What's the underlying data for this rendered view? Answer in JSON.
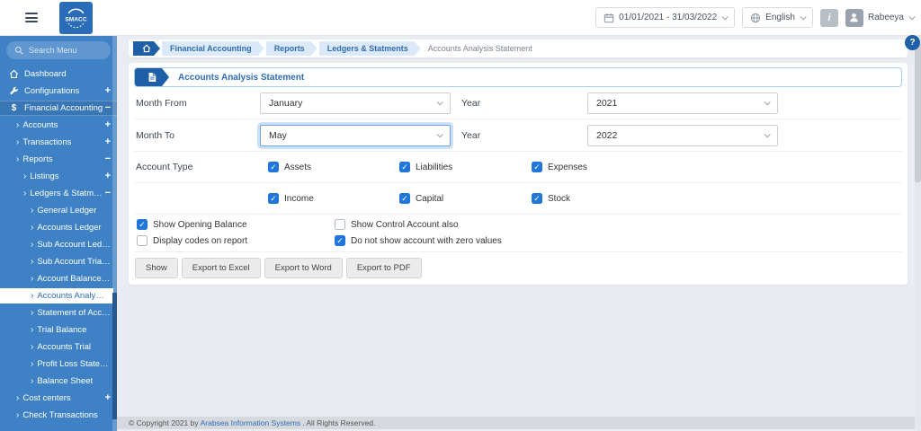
{
  "topbar": {
    "logo_text": "SMACC",
    "date_range": "01/01/2021 - 31/03/2022",
    "language": "English",
    "info_label": "i",
    "user_name": "Rabeeya"
  },
  "sidebar": {
    "search_placeholder": "Search Menu",
    "items": [
      {
        "label": "Dashboard",
        "level": 0,
        "icon": "home-icon",
        "expander": ""
      },
      {
        "label": "Configurations",
        "level": 0,
        "icon": "wrench-icon",
        "expander": "+"
      },
      {
        "label": "Financial Accounting",
        "level": 0,
        "icon": "dollar-icon",
        "expander": "-",
        "open": true
      },
      {
        "label": "Accounts",
        "level": 1,
        "expander": "+"
      },
      {
        "label": "Transactions",
        "level": 1,
        "expander": "+"
      },
      {
        "label": "Reports",
        "level": 1,
        "expander": "-"
      },
      {
        "label": "Listings",
        "level": 2,
        "expander": "+"
      },
      {
        "label": "Ledgers & Statments",
        "level": 2,
        "expander": "-"
      },
      {
        "label": "General Ledger",
        "level": 3,
        "expander": ""
      },
      {
        "label": "Accounts Ledger",
        "level": 3,
        "expander": ""
      },
      {
        "label": "Sub Account Ledger",
        "level": 3,
        "expander": ""
      },
      {
        "label": "Sub Account Trial Balance",
        "level": 3,
        "expander": ""
      },
      {
        "label": "Account Balance Ageing",
        "level": 3,
        "expander": ""
      },
      {
        "label": "Accounts Analysis Statement",
        "level": 3,
        "expander": "",
        "selected": true
      },
      {
        "label": "Statement of Accounts",
        "level": 3,
        "expander": ""
      },
      {
        "label": "Trial Balance",
        "level": 3,
        "expander": ""
      },
      {
        "label": "Accounts Trial",
        "level": 3,
        "expander": ""
      },
      {
        "label": "Profit Loss Statement",
        "level": 3,
        "expander": ""
      },
      {
        "label": "Balance Sheet",
        "level": 3,
        "expander": ""
      },
      {
        "label": "Cost centers",
        "level": 1,
        "expander": "+"
      },
      {
        "label": "Check Transactions",
        "level": 1,
        "expander": ""
      }
    ]
  },
  "breadcrumb": [
    "Financial Accounting",
    "Reports",
    "Ledgers & Statments",
    "Accounts Analysis Statement"
  ],
  "panel": {
    "title": "Accounts Analysis Statement",
    "month_from": {
      "label": "Month From",
      "value": "January"
    },
    "year_from": {
      "label": "Year",
      "value": "2021"
    },
    "month_to": {
      "label": "Month To",
      "value": "May"
    },
    "year_to": {
      "label": "Year",
      "value": "2022"
    },
    "account_type_label": "Account Type",
    "account_types": [
      {
        "label": "Assets",
        "checked": true
      },
      {
        "label": "Liabilities",
        "checked": true
      },
      {
        "label": "Expenses",
        "checked": true
      },
      {
        "label": "Income",
        "checked": true
      },
      {
        "label": "Capital",
        "checked": true
      },
      {
        "label": "Stock",
        "checked": true
      }
    ],
    "options": [
      {
        "label": "Show Opening Balance",
        "checked": true,
        "col": 0,
        "row": 0
      },
      {
        "label": "Display codes on report",
        "checked": false,
        "col": 0,
        "row": 1
      },
      {
        "label": "Show Control Account also",
        "checked": false,
        "col": 1,
        "row": 0
      },
      {
        "label": "Do not show account with zero values",
        "checked": true,
        "col": 1,
        "row": 1
      }
    ],
    "buttons": [
      "Show",
      "Export to Excel",
      "Export to Word",
      "Export to PDF"
    ]
  },
  "footer": {
    "prefix": "© Copyright 2021 by",
    "link": "Arabsea Information Systems",
    "suffix": ". All Rights Reserved."
  },
  "colors": {
    "sidebar_blue": "#3e81c5",
    "accent_blue": "#1e5fa8",
    "checkbox_blue": "#2176d9",
    "link_blue": "#2e6db4"
  }
}
